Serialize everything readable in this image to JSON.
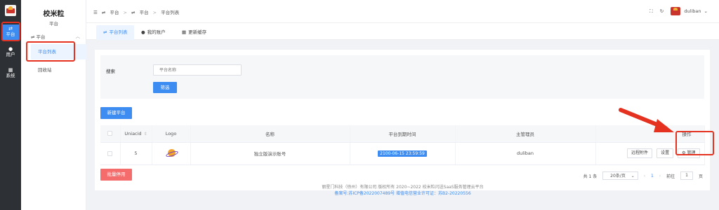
{
  "rail": {
    "items": [
      {
        "icon": "swap-icon",
        "label": "平台"
      },
      {
        "icon": "user-icon",
        "label": "用户"
      },
      {
        "icon": "windows-icon",
        "label": "系统"
      }
    ]
  },
  "sidebar": {
    "title": "校米粒",
    "subtitle": "平台",
    "group_label": "平台",
    "items": [
      {
        "label": "平台列表"
      },
      {
        "label": "回收站"
      }
    ]
  },
  "header": {
    "breadcrumb": [
      "平台",
      "平台",
      "平台列表"
    ],
    "username": "duliban"
  },
  "tabs": [
    {
      "label": "平台列表"
    },
    {
      "label": "我的账户"
    },
    {
      "label": "更新缓存"
    }
  ],
  "filter": {
    "label": "搜索",
    "placeholder": "平台名称",
    "button": "筛选"
  },
  "new_button": "新建平台",
  "table": {
    "columns": [
      "Uniacid",
      "Logo",
      "名称",
      "平台到期时间",
      "主管理员",
      "操作"
    ],
    "rows": [
      {
        "uniacid": "5",
        "name": "独立版演示账号",
        "expiry": "2100-06-15 23:59:59",
        "admin": "duliban",
        "actions": [
          "远程附件",
          "设置",
          "管理"
        ]
      }
    ]
  },
  "bulk_button": "批量停用",
  "pagination": {
    "total": "共 1 条",
    "page_size": "20条/页",
    "current_page": "1",
    "goto_label": "前往",
    "goto_value": "1",
    "page_suffix": "页"
  },
  "footer": {
    "line1": "丽星门科技（徐州）有限公司 版权所有 2020~2022 校米粒闪送SaaS服务管理云平台",
    "line2": "备案号:苏ICP备2022007489号 增值电信营业许可证：苏B2-20220556"
  },
  "colors": {
    "accent": "#3c8cf2",
    "danger": "#f56c6c",
    "annotation": "#e5311f",
    "rail_bg": "#2d3035"
  }
}
